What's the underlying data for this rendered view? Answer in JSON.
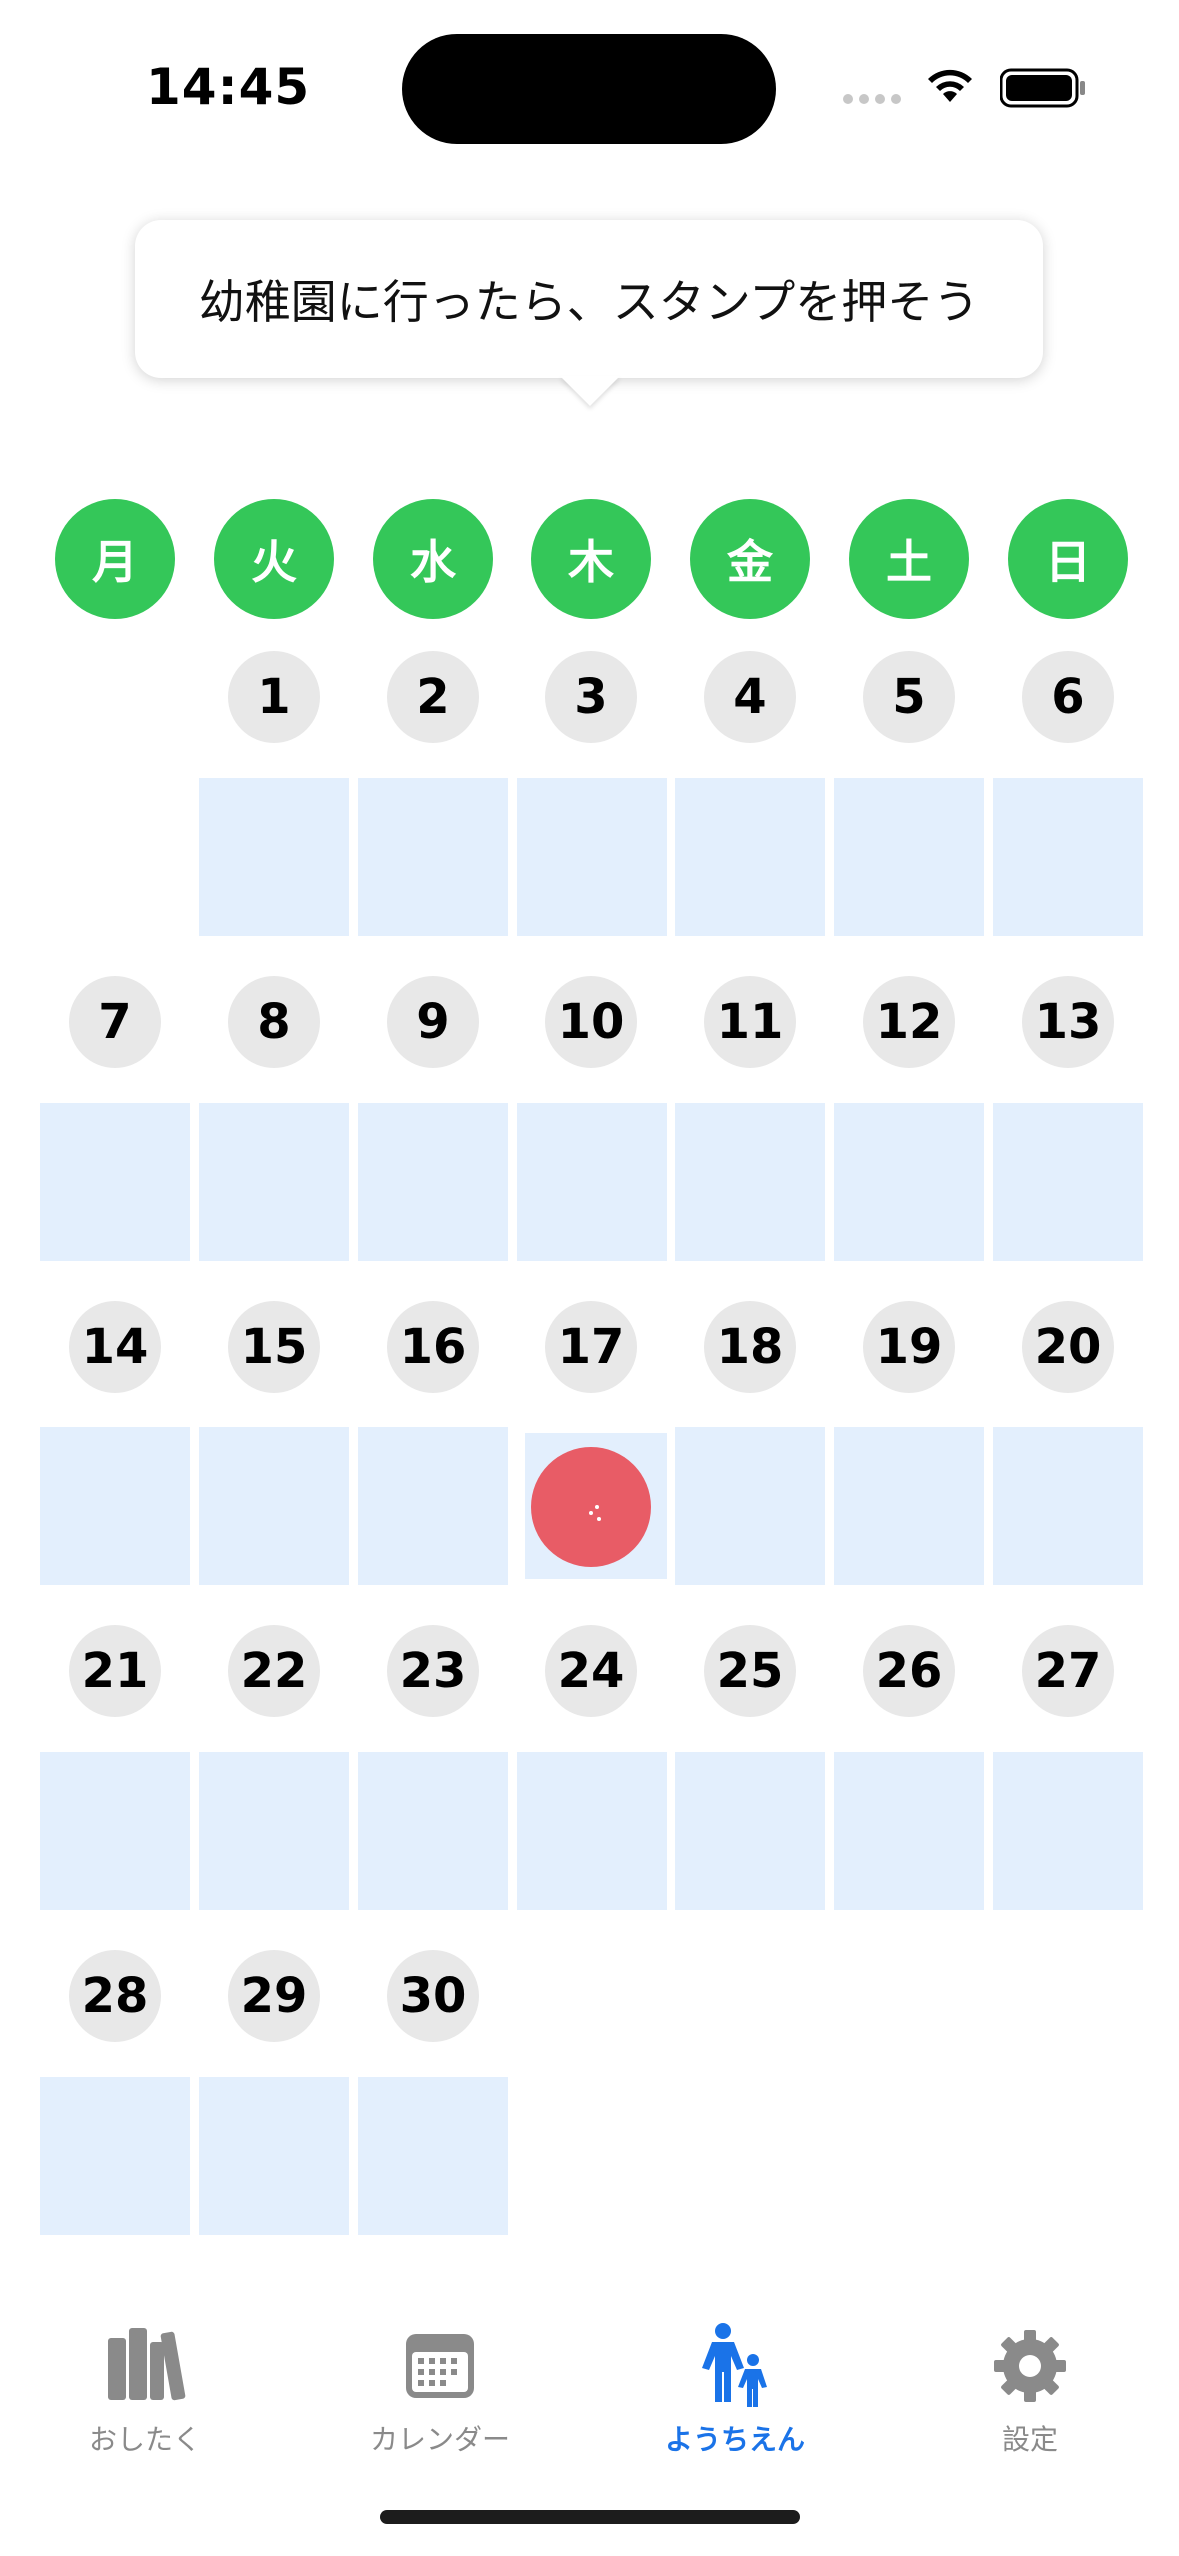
{
  "status_bar": {
    "time": "14:45"
  },
  "tooltip": {
    "text": "幼稚園に行ったら、スタンプを押そう"
  },
  "weekdays": [
    "月",
    "火",
    "水",
    "木",
    "金",
    "土",
    "日"
  ],
  "calendar": {
    "days": [
      {
        "label": "1"
      },
      {
        "label": "2"
      },
      {
        "label": "3"
      },
      {
        "label": "4"
      },
      {
        "label": "5"
      },
      {
        "label": "6"
      },
      {
        "label": "7"
      },
      {
        "label": "8"
      },
      {
        "label": "9"
      },
      {
        "label": "10"
      },
      {
        "label": "11"
      },
      {
        "label": "12"
      },
      {
        "label": "13"
      },
      {
        "label": "14"
      },
      {
        "label": "15"
      },
      {
        "label": "16"
      },
      {
        "label": "17"
      },
      {
        "label": "18"
      },
      {
        "label": "19"
      },
      {
        "label": "20"
      },
      {
        "label": "21"
      },
      {
        "label": "22"
      },
      {
        "label": "23"
      },
      {
        "label": "24"
      },
      {
        "label": "25"
      },
      {
        "label": "26"
      },
      {
        "label": "27"
      },
      {
        "label": "28"
      },
      {
        "label": "29"
      },
      {
        "label": "30"
      }
    ],
    "stamped_days": [
      "17"
    ],
    "stamp_color": "#e85c66",
    "cell_color": "#e3effd",
    "header_color": "#34c759"
  },
  "tabbar": {
    "items": [
      {
        "label": "おしたく",
        "icon": "books-icon"
      },
      {
        "label": "カレンダー",
        "icon": "calendar-icon"
      },
      {
        "label": "ようちえん",
        "icon": "parent-child-icon"
      },
      {
        "label": "設定",
        "icon": "gear-icon"
      }
    ],
    "active": "ようちえん",
    "active_color": "#1a73e8"
  }
}
